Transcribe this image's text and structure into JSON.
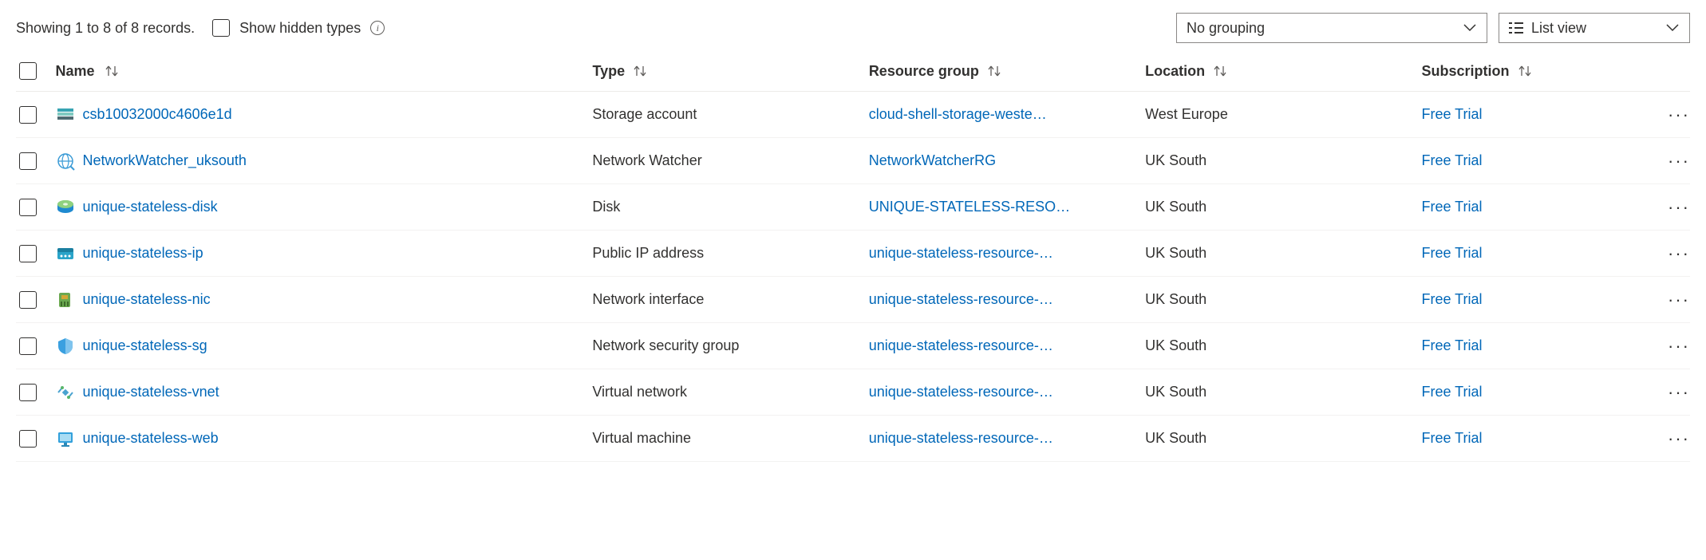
{
  "toolbar": {
    "record_summary": "Showing 1 to 8 of 8 records.",
    "show_hidden_label": "Show hidden types",
    "grouping_selected": "No grouping",
    "view_selected": "List view"
  },
  "columns": {
    "name": "Name",
    "type": "Type",
    "resource_group": "Resource group",
    "location": "Location",
    "subscription": "Subscription"
  },
  "rows": [
    {
      "icon": "storage-account",
      "name": "csb10032000c4606e1d",
      "type": "Storage account",
      "rg": "cloud-shell-storage-weste…",
      "loc": "West Europe",
      "sub": "Free Trial"
    },
    {
      "icon": "network-watcher",
      "name": "NetworkWatcher_uksouth",
      "type": "Network Watcher",
      "rg": "NetworkWatcherRG",
      "loc": "UK South",
      "sub": "Free Trial"
    },
    {
      "icon": "disk",
      "name": "unique-stateless-disk",
      "type": "Disk",
      "rg": "UNIQUE-STATELESS-RESO…",
      "loc": "UK South",
      "sub": "Free Trial"
    },
    {
      "icon": "public-ip",
      "name": "unique-stateless-ip",
      "type": "Public IP address",
      "rg": "unique-stateless-resource-…",
      "loc": "UK South",
      "sub": "Free Trial"
    },
    {
      "icon": "nic",
      "name": "unique-stateless-nic",
      "type": "Network interface",
      "rg": "unique-stateless-resource-…",
      "loc": "UK South",
      "sub": "Free Trial"
    },
    {
      "icon": "nsg",
      "name": "unique-stateless-sg",
      "type": "Network security group",
      "rg": "unique-stateless-resource-…",
      "loc": "UK South",
      "sub": "Free Trial"
    },
    {
      "icon": "vnet",
      "name": "unique-stateless-vnet",
      "type": "Virtual network",
      "rg": "unique-stateless-resource-…",
      "loc": "UK South",
      "sub": "Free Trial"
    },
    {
      "icon": "vm",
      "name": "unique-stateless-web",
      "type": "Virtual machine",
      "rg": "unique-stateless-resource-…",
      "loc": "UK South",
      "sub": "Free Trial"
    }
  ]
}
